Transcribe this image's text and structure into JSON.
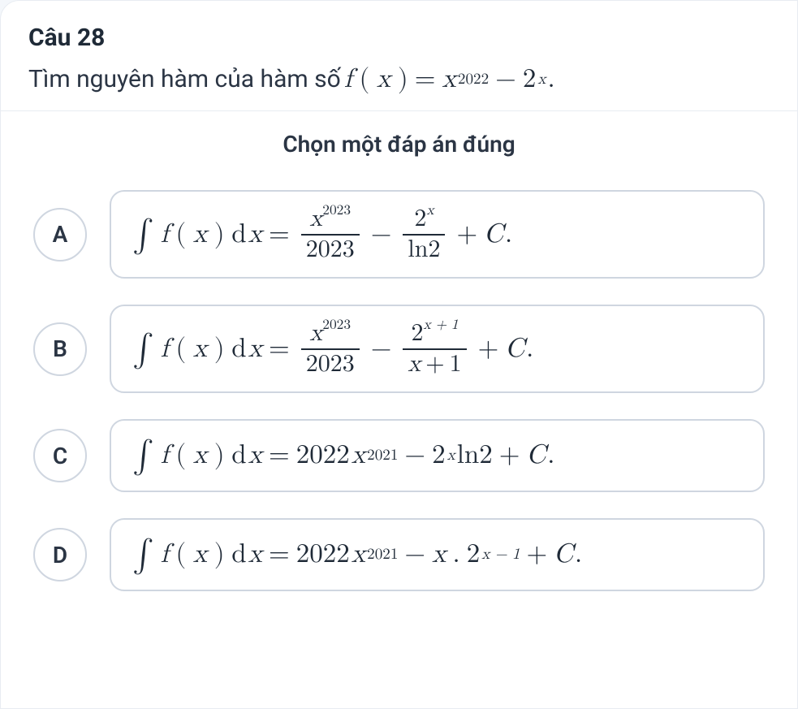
{
  "question": {
    "number_label": "Câu 28",
    "stem_prefix": "Tìm nguyên hàm của hàm số",
    "function_lhs_f": "f",
    "function_lhs_x": "x",
    "rhs_xexp": "2022",
    "rhs_base2": "2",
    "rhs_2exp": "x",
    "period": "."
  },
  "instruction": "Chọn một đáp án đúng",
  "common": {
    "int": "∫",
    "f": "f",
    "x": "x",
    "d": "d",
    "eq": "=",
    "minus": "−",
    "plus": "+",
    "C": "C",
    "dot": "."
  },
  "options": [
    {
      "key": "A",
      "frac1_num_base": "x",
      "frac1_num_exp": "2023",
      "frac1_den": "2023",
      "frac2_num_base": "2",
      "frac2_num_exp": "x",
      "frac2_den": "ln2"
    },
    {
      "key": "B",
      "frac1_num_base": "x",
      "frac1_num_exp": "2023",
      "frac1_den": "2023",
      "frac2_num_base": "2",
      "frac2_num_exp": "x + 1",
      "frac2_den_l": "x",
      "frac2_den_op": "+",
      "frac2_den_r": "1"
    },
    {
      "key": "C",
      "coef1": "2022",
      "x1_exp": "2021",
      "t2_base": "2",
      "t2_exp": "x",
      "t2_tail": "ln2"
    },
    {
      "key": "D",
      "coef1": "2022",
      "x1_exp": "2021",
      "mid_x": "x",
      "t2_base": "2",
      "t2_exp": "x − 1"
    }
  ]
}
